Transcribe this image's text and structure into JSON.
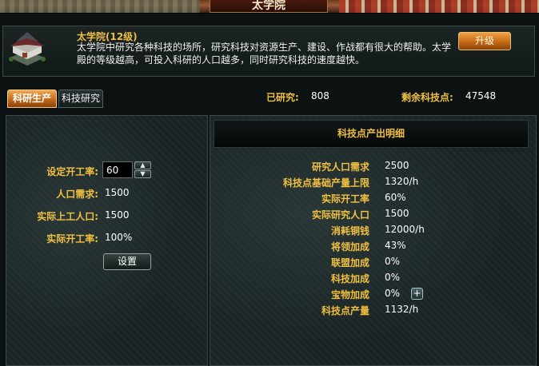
{
  "window": {
    "title": "太学院"
  },
  "building": {
    "title": "太学院(12级)",
    "description": "太学院中研究各种科技的场所，研究科技对资源生产、建设、作战都有很大的帮助。太学殿的等级越高，可投入科研的人口越多，同时研究科技的速度越快。",
    "upgrade_label": "升级"
  },
  "tabs": [
    {
      "label": "科研生产",
      "active": true
    },
    {
      "label": "科技研究",
      "active": false
    }
  ],
  "stats": {
    "researched_label": "已研究:",
    "researched_value": "808",
    "remaining_label": "剩余科技点:",
    "remaining_value": "47548"
  },
  "left": {
    "rate_label": "设定开工率:",
    "rate_value": "60",
    "pop_need_label": "人口需求:",
    "pop_need_value": "1500",
    "actual_workers_label": "实际上工人口:",
    "actual_workers_value": "1500",
    "actual_rate_label": "实际开工率:",
    "actual_rate_value": "100%",
    "set_label": "设置"
  },
  "detail": {
    "title": "科技点产出明细",
    "rows": [
      {
        "label": "研究人口需求",
        "value": "2500"
      },
      {
        "label": "科技点基础产量上限",
        "value": "1320/h"
      },
      {
        "label": "实际开工率",
        "value": "60%"
      },
      {
        "label": "实际研究人口",
        "value": "1500"
      },
      {
        "label": "消耗铜钱",
        "value": "12000/h"
      },
      {
        "label": "将领加成",
        "value": "43%"
      },
      {
        "label": "联盟加成",
        "value": "0%"
      },
      {
        "label": "科技加成",
        "value": "0%"
      },
      {
        "label": "宝物加成",
        "value": "0%"
      },
      {
        "label": "科技点产量",
        "value": "1132/h"
      }
    ]
  },
  "colors": {
    "label_gold": "#f0c040",
    "accent_orange": "#d07820"
  },
  "icons": {
    "plus": "plus-icon",
    "stepper_up": "chevron-up-icon",
    "stepper_down": "chevron-down-icon"
  }
}
